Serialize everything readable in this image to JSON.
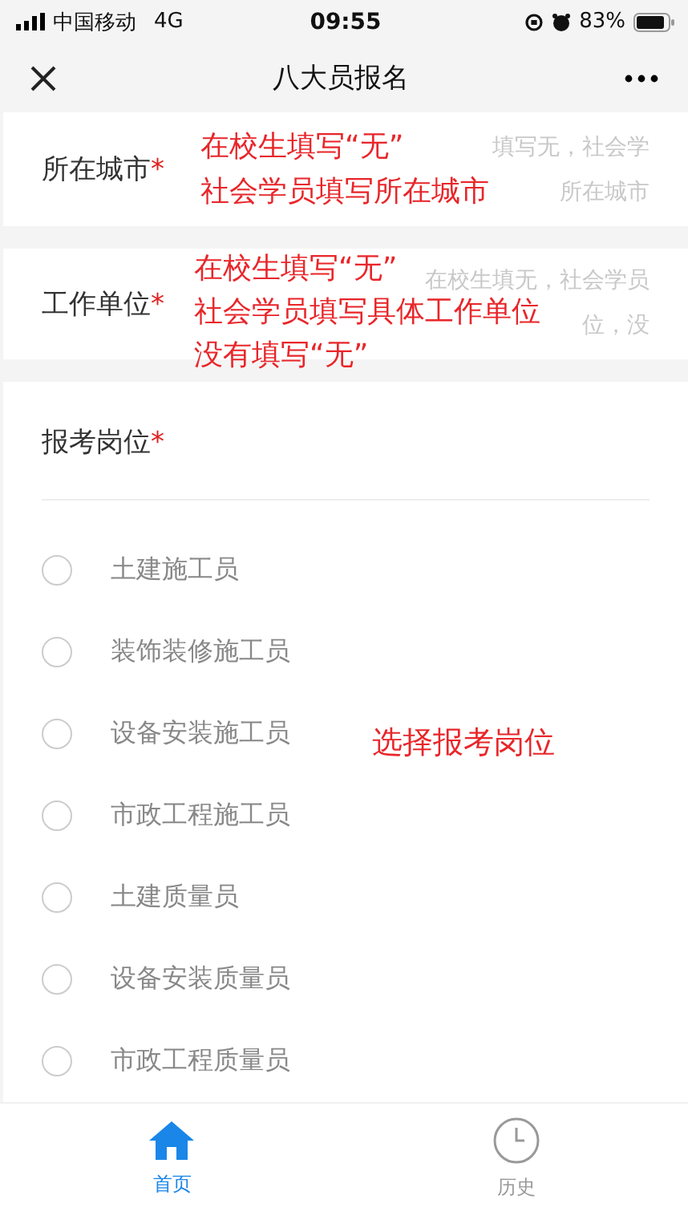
{
  "status_bar": {
    "carrier": "中国移动",
    "network": "4G",
    "time": "09:55",
    "battery": "83%"
  },
  "nav": {
    "title": "八大员报名"
  },
  "fields": [
    {
      "label": "所在城市",
      "required_mark": "*",
      "placeholder_lines": [
        "填写无，社会学",
        "所在城市"
      ],
      "annotation_lines": [
        "在校生填写“无”",
        "社会学员填写所在城市"
      ]
    },
    {
      "label": "工作单位",
      "required_mark": "*",
      "placeholder_lines": [
        "在校生填无，社会学员",
        "位，没"
      ],
      "annotation_lines": [
        "在校生填写“无”",
        "社会学员填写具体工作单位",
        "没有填写“无”"
      ]
    }
  ],
  "position": {
    "label": "报考岗位",
    "required_mark": "*",
    "annotation": "选择报考岗位",
    "options": [
      {
        "label": "土建施工员",
        "selected": false
      },
      {
        "label": "装饰装修施工员",
        "selected": false
      },
      {
        "label": "设备安装施工员",
        "selected": false
      },
      {
        "label": "市政工程施工员",
        "selected": false
      },
      {
        "label": "土建质量员",
        "selected": false
      },
      {
        "label": "设备安装质量员",
        "selected": false
      },
      {
        "label": "市政工程质量员",
        "selected": false
      }
    ]
  },
  "tabbar": [
    {
      "label": "首页",
      "kind": "home",
      "selected": true
    },
    {
      "label": "历史",
      "kind": "history",
      "selected": false
    }
  ]
}
